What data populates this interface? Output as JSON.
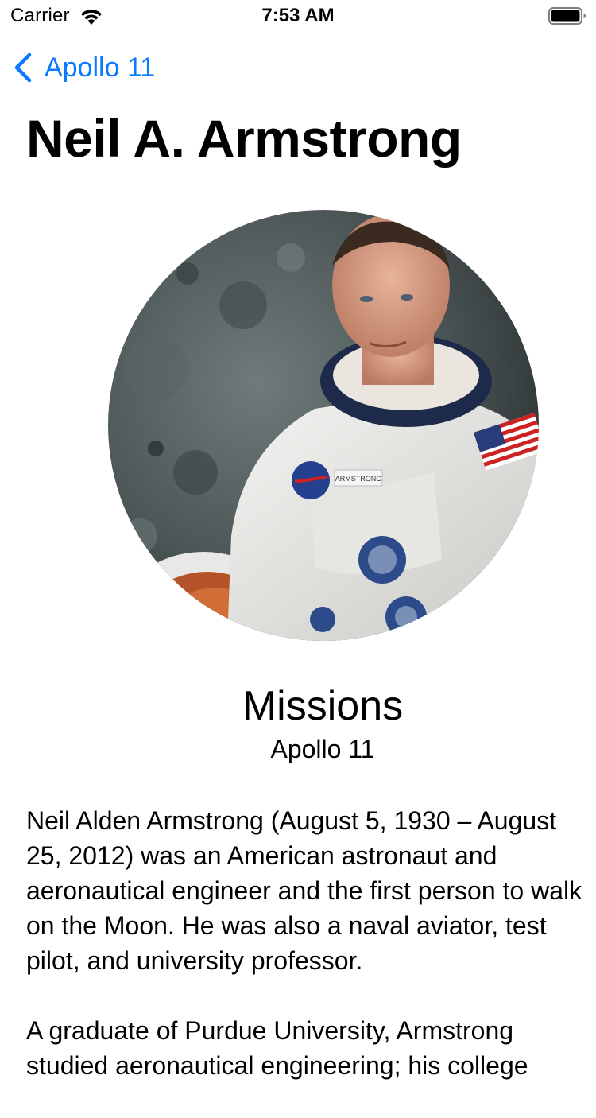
{
  "status_bar": {
    "carrier": "Carrier",
    "time": "7:53 AM"
  },
  "nav": {
    "back_label": "Apollo 11",
    "accent_color": "#0a7aff"
  },
  "title": "Neil A. Armstrong",
  "portrait": {
    "icon": "astronaut-portrait-image",
    "badge_text": "ARMSTRONG"
  },
  "missions": {
    "heading": "Missions",
    "items": [
      "Apollo 11"
    ]
  },
  "bio": {
    "paragraph1": "Neil Alden Armstrong (August 5, 1930 – August\n25, 2012) was an American astronaut and\naeronautical engineer and the first person to walk\non the Moon. He was also a naval aviator, test\npilot, and university professor.",
    "paragraph2": "A graduate of Purdue University, Armstrong\nstudied aeronautical engineering; his college"
  }
}
